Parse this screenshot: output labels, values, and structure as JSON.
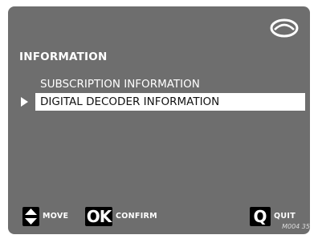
{
  "screen": {
    "title": "INFORMATION",
    "logo_icon": "decoder-ring-logo-icon"
  },
  "menu": {
    "items": [
      {
        "label": "SUBSCRIPTION INFORMATION",
        "selected": false
      },
      {
        "label": "DIGITAL DECODER INFORMATION",
        "selected": true
      }
    ]
  },
  "footer": {
    "move": {
      "key_icon": "up-down-arrows-icon",
      "label": "MOVE"
    },
    "confirm": {
      "key": "OK",
      "label": "CONFIRM"
    },
    "quit": {
      "key": "Q",
      "label": "QUIT"
    },
    "code": "M004 35"
  },
  "colors": {
    "screen_bg": "#6e6e6e",
    "text": "#ffffff",
    "selected_bg": "#ffffff",
    "selected_text": "#111111",
    "key_bg": "#000000"
  }
}
